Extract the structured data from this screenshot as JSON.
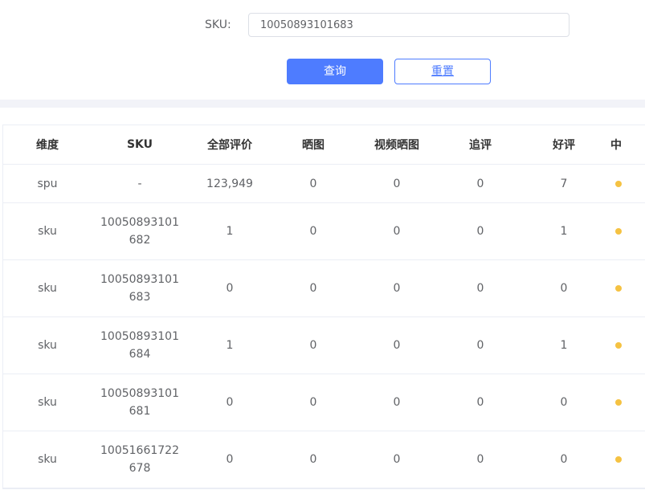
{
  "search": {
    "sku_label": "SKU:",
    "sku_value": "10050893101683",
    "query_label": "查询",
    "reset_label": "重置"
  },
  "table": {
    "headers": [
      "维度",
      "SKU",
      "全部评价",
      "晒图",
      "视频晒图",
      "追评",
      "好评",
      "中"
    ],
    "rows": [
      {
        "dimension": "spu",
        "sku": "-",
        "all": "123,949",
        "photo": "0",
        "video": "0",
        "followup": "0",
        "good": "7"
      },
      {
        "dimension": "sku",
        "sku": "10050893101682",
        "all": "1",
        "photo": "0",
        "video": "0",
        "followup": "0",
        "good": "1"
      },
      {
        "dimension": "sku",
        "sku": "10050893101683",
        "all": "0",
        "photo": "0",
        "video": "0",
        "followup": "0",
        "good": "0"
      },
      {
        "dimension": "sku",
        "sku": "10050893101684",
        "all": "1",
        "photo": "0",
        "video": "0",
        "followup": "0",
        "good": "1"
      },
      {
        "dimension": "sku",
        "sku": "10050893101681",
        "all": "0",
        "photo": "0",
        "video": "0",
        "followup": "0",
        "good": "0"
      },
      {
        "dimension": "sku",
        "sku": "10051661722678",
        "all": "0",
        "photo": "0",
        "video": "0",
        "followup": "0",
        "good": "0"
      }
    ]
  },
  "colors": {
    "primary": "#4e7cff",
    "status_dot": "#f5c242",
    "band": "#f2f3f8"
  }
}
